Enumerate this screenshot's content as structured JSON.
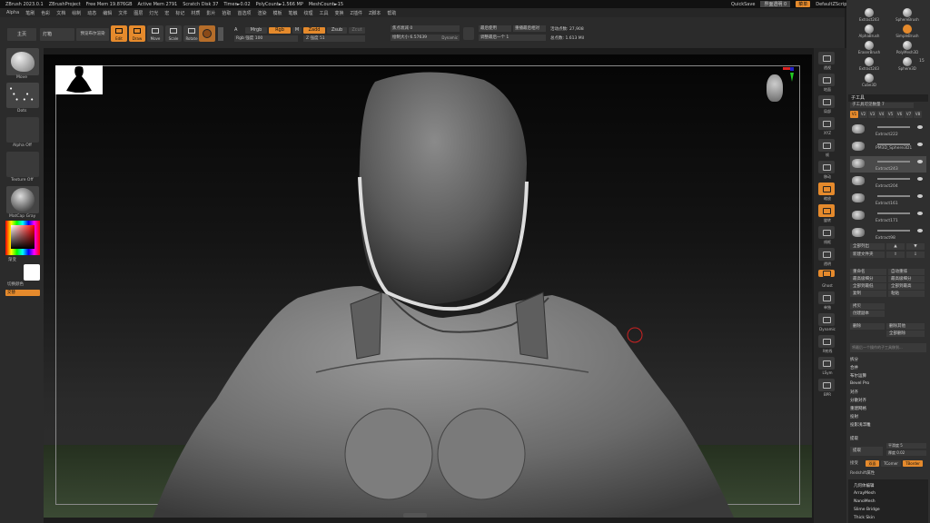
{
  "titlebar": {
    "app": "ZBrush 2023.0.1",
    "project": "ZBrushProject",
    "free_mem": "Free Mem 19.876GB",
    "active_mem": "Active Mem 2791",
    "scratch": "Scratch Disk 37",
    "timer": "Timer►0.02",
    "polycount": "PolyCount►1.566 MP",
    "meshcount": "MeshCount►15",
    "quicksave": "QuickSave",
    "transparency": "界面透明 0",
    "menus_btn": "菜单",
    "script": "DefaultZScript"
  },
  "menubar": [
    "Alpha",
    "笔刷",
    "色彩",
    "文档",
    "绘制",
    "动态",
    "编辑",
    "文件",
    "图层",
    "灯光",
    "宏",
    "标记",
    "材质",
    "影片",
    "拾取",
    "首选项",
    "渲染",
    "模板",
    "笔触",
    "纹理",
    "工具",
    "变换",
    "Z插件",
    "Z脚本",
    "帮助"
  ],
  "toolbar": {
    "home": "主页",
    "lightbox": "灯箱",
    "preview": "预览布尔渲染",
    "tools": [
      {
        "label": "Edit",
        "on": true
      },
      {
        "label": "Draw",
        "on": true
      },
      {
        "label": "Move",
        "on": false
      },
      {
        "label": "Scale",
        "on": false
      },
      {
        "label": "Rotate",
        "on": false
      }
    ],
    "a_label": "A",
    "mrgb": "Mrgb",
    "rgb": "Rgb",
    "m": "M",
    "rgb_intensity": "Rgb 强度 100",
    "zadd": "Zadd",
    "zsub": "Zsub",
    "zcut": "Zcut",
    "z_intensity": "Z 强度 51",
    "focal_shift": "焦点衰减 0",
    "draw_size": "绘制大小 6.57639",
    "dynamic": "Dynamic",
    "draw_size_btn": "绘制大小",
    "active_points": "活动点数: 27,908",
    "total_points": "总点数: 1.613 Mil",
    "last_used": "最后使用",
    "adjust_last": "调整最后一个 1",
    "backface": "重播最后相对"
  },
  "leftpanel": {
    "brush": "Move",
    "stroke": "Dots",
    "alpha": "Alpha Off",
    "texture": "Texture Off",
    "material": "MatCap Gray",
    "gradient": "渐变",
    "switch_color": "切换颜色",
    "alternate": "交替"
  },
  "rightshelf": [
    "透视",
    "地面",
    "局部",
    "XYZ",
    "帧",
    "移动",
    "缩放",
    "旋转",
    "线框",
    "透明",
    "Ghost",
    "单独",
    "Dynamic",
    "X射线",
    "LSym",
    "BPR"
  ],
  "rightpanel": {
    "brushes": [
      "Extract243",
      "SphereBrush",
      "AlphaBrush",
      "SimpleBrush",
      "EraserBrush",
      "PolyMesh3D",
      "Extract243",
      "Sphere3D",
      "Cube3D"
    ],
    "count": "15",
    "subtool_header": "子工具",
    "visible_count": "子工具可见数量 7",
    "vtabs": [
      "V1",
      "V2",
      "V3",
      "V4",
      "V5",
      "V6",
      "V7",
      "V8"
    ],
    "subtools": [
      "Extract222",
      "PM3D_Sphere3D1",
      "Extract243",
      "Extract204",
      "Extract161",
      "Extract171",
      "Extract98"
    ],
    "list_all": "全部列出",
    "new_folder": "新建文件夹",
    "ops": [
      [
        "重命名",
        "自动重排"
      ],
      [
        "最高级细分",
        "最高级细分"
      ],
      [
        "全部到最低",
        "全部到最高"
      ],
      [
        "复制",
        "粘贴"
      ],
      [
        "插入",
        "拆分"
      ],
      [
        "删除",
        "合并"
      ]
    ],
    "copy": "拷贝",
    "duplicate": "创建副本",
    "delete_btn": "删除",
    "delete_other": "删除其他",
    "delete_all": "全部删除",
    "move_hint": "将最后一个操作的子工具移到...",
    "sections": [
      "拆分",
      "合并",
      "布尔运算",
      "Bevel Pro",
      "对齐",
      "分散对齐",
      "重建网格",
      "投射",
      "投影浅浮雕"
    ],
    "extract": "提取",
    "extract_btn": "提取",
    "thickness": "厚度 0.02",
    "smooth": "平滑度 5",
    "accept": "接受",
    "double": "双面",
    "tcorner": "TCorner",
    "tborder": "TBorder",
    "redshift": "Redshift属性",
    "geometry": "几何体编辑",
    "geo_items": [
      "ArrayMesh",
      "NanoMesh",
      "Slime Bridge",
      "Thick Skin"
    ]
  }
}
